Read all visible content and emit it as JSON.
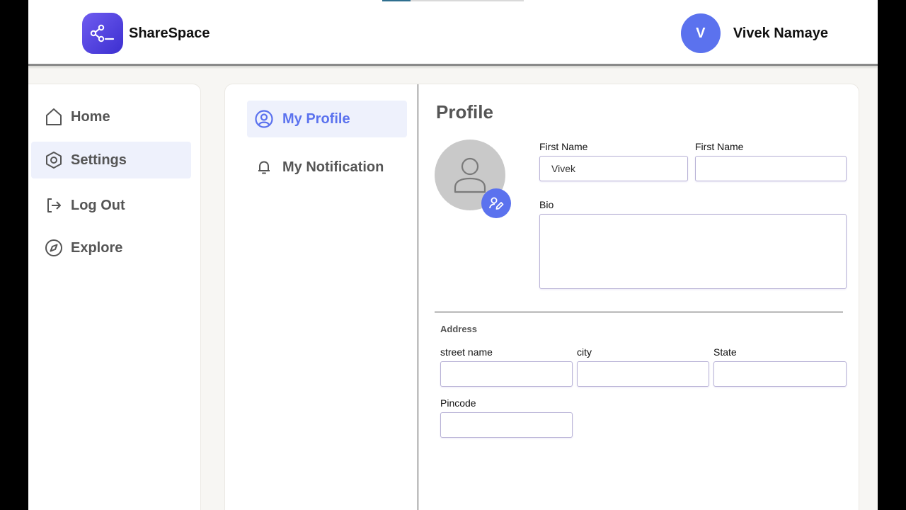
{
  "header": {
    "app_title": "ShareSpace",
    "logo_icon": "share-icon",
    "user": {
      "initial": "V",
      "name": "Vivek Namaye"
    }
  },
  "sidebar": {
    "items": [
      {
        "label": "Home",
        "icon": "home-icon",
        "active": false
      },
      {
        "label": "Settings",
        "icon": "settings-icon",
        "active": true
      },
      {
        "label": "Log Out",
        "icon": "logout-icon",
        "active": false
      },
      {
        "label": "Explore",
        "icon": "compass-icon",
        "active": false
      }
    ]
  },
  "settings_nav": {
    "items": [
      {
        "label": "My Profile",
        "icon": "user-circle-icon",
        "active": true
      },
      {
        "label": "My Notification",
        "icon": "bell-icon",
        "active": false
      }
    ]
  },
  "profile": {
    "title": "Profile",
    "first_name_label": "First Name",
    "first_name_value": "Vivek",
    "second_name_label": "First Name",
    "second_name_value": "",
    "bio_label": "Bio",
    "bio_value": ""
  },
  "address": {
    "section_label": "Address",
    "street_label": "street name",
    "street_value": "",
    "city_label": "city",
    "city_value": "",
    "state_label": "State",
    "state_value": "",
    "pincode_label": "Pincode",
    "pincode_value": ""
  },
  "colors": {
    "accent": "#5b72ee",
    "logo_gradient_start": "#6f5cf0",
    "logo_gradient_end": "#3c2fd0",
    "active_bg": "#eef1fc",
    "avatar_placeholder": "#c9c9c9"
  }
}
